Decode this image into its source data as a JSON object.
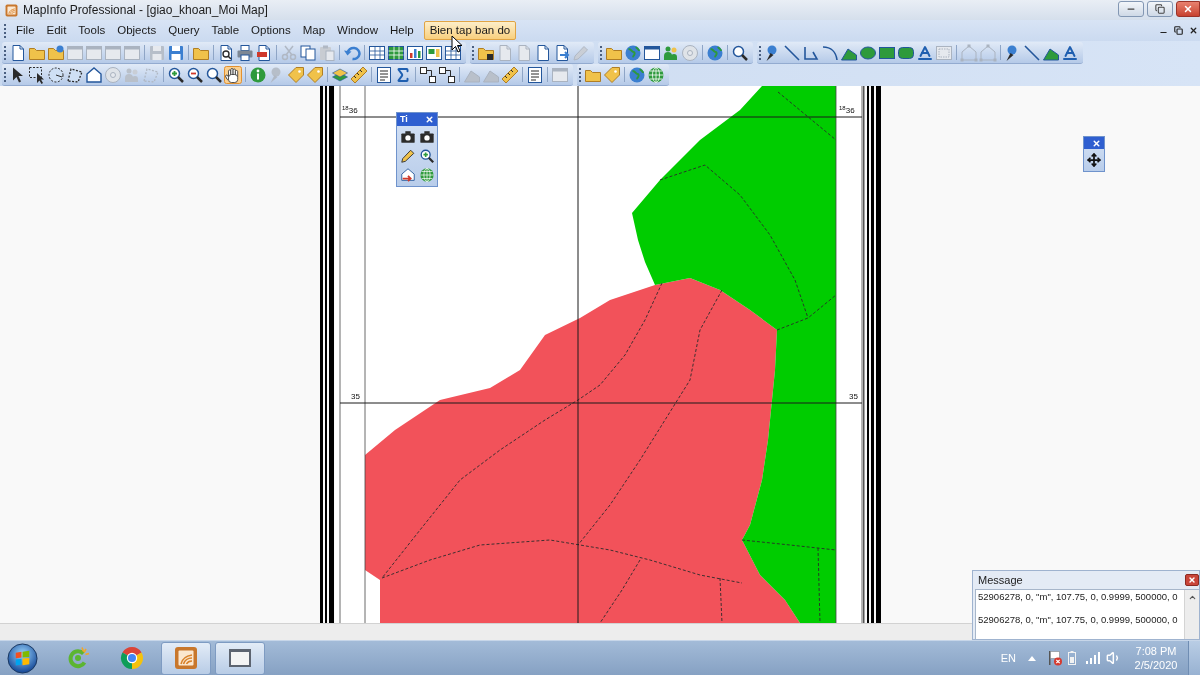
{
  "window": {
    "title": "MapInfo Professional - [giao_khoan_Moi Map]"
  },
  "menu": [
    {
      "label": "File",
      "selected": false
    },
    {
      "label": "Edit",
      "selected": false
    },
    {
      "label": "Tools",
      "selected": false
    },
    {
      "label": "Objects",
      "selected": false
    },
    {
      "label": "Query",
      "selected": false
    },
    {
      "label": "Table",
      "selected": false
    },
    {
      "label": "Options",
      "selected": false
    },
    {
      "label": "Map",
      "selected": false
    },
    {
      "label": "Window",
      "selected": false
    },
    {
      "label": "Help",
      "selected": false
    },
    {
      "label": "Bien tap ban do",
      "selected": true
    }
  ],
  "toolbar_rows": [
    [
      {
        "groups": [
          [
            {
              "disabled": false,
              "selected": false
            },
            {
              "disabled": false,
              "selected": false
            },
            {
              "disabled": false,
              "selected": false
            },
            {
              "disabled": true,
              "selected": false
            },
            {
              "disabled": true,
              "selected": false
            },
            {
              "disabled": true,
              "selected": false
            },
            {
              "disabled": true,
              "selected": false
            }
          ],
          [
            {
              "disabled": true,
              "selected": false
            },
            {
              "disabled": false,
              "selected": false
            }
          ],
          [
            {
              "disabled": false,
              "selected": false
            }
          ],
          [
            {
              "disabled": false,
              "selected": false
            },
            {
              "disabled": false,
              "selected": false
            },
            {
              "disabled": false,
              "selected": false
            }
          ],
          [
            {
              "disabled": true,
              "selected": false
            },
            {
              "disabled": false,
              "selected": false
            },
            {
              "disabled": true,
              "selected": false
            }
          ],
          [
            {
              "disabled": false,
              "selected": false
            }
          ],
          [
            {
              "disabled": false,
              "selected": false
            },
            {
              "disabled": false,
              "selected": false
            },
            {
              "disabled": false,
              "selected": false
            },
            {
              "disabled": false,
              "selected": false
            },
            {
              "disabled": false,
              "selected": false
            }
          ]
        ]
      },
      {
        "groups": [
          [
            {
              "disabled": false,
              "selected": false
            },
            {
              "disabled": true,
              "selected": false
            },
            {
              "disabled": true,
              "selected": false
            },
            {
              "disabled": false,
              "selected": false
            },
            {
              "disabled": false,
              "selected": false
            },
            {
              "disabled": true,
              "selected": false
            }
          ]
        ]
      },
      {
        "groups": [
          [
            {
              "disabled": false,
              "selected": false
            },
            {
              "disabled": false,
              "selected": false
            },
            {
              "disabled": false,
              "selected": false
            },
            {
              "disabled": false,
              "selected": false
            },
            {
              "disabled": true,
              "selected": false
            }
          ],
          [
            {
              "disabled": false,
              "selected": false
            }
          ],
          [
            {
              "disabled": false,
              "selected": false
            }
          ]
        ]
      },
      {
        "groups": [
          [
            {
              "disabled": false,
              "selected": false
            },
            {
              "disabled": false,
              "selected": false
            },
            {
              "disabled": false,
              "selected": false
            },
            {
              "disabled": false,
              "selected": false
            },
            {
              "disabled": false,
              "selected": false
            },
            {
              "disabled": false,
              "selected": false
            },
            {
              "disabled": false,
              "selected": false
            },
            {
              "disabled": false,
              "selected": false
            },
            {
              "disabled": false,
              "selected": false
            },
            {
              "disabled": true,
              "selected": false
            }
          ],
          [
            {
              "disabled": true,
              "selected": false
            },
            {
              "disabled": true,
              "selected": false
            }
          ],
          [
            {
              "disabled": false,
              "selected": false
            },
            {
              "disabled": false,
              "selected": false
            },
            {
              "disabled": false,
              "selected": false
            },
            {
              "disabled": false,
              "selected": false
            }
          ]
        ]
      }
    ],
    [
      {
        "groups": [
          [
            {
              "disabled": false,
              "selected": false
            },
            {
              "disabled": false,
              "selected": false
            },
            {
              "disabled": false,
              "selected": false
            },
            {
              "disabled": false,
              "selected": false
            },
            {
              "disabled": false,
              "selected": false
            },
            {
              "disabled": true,
              "selected": false
            },
            {
              "disabled": true,
              "selected": false
            },
            {
              "disabled": true,
              "selected": false
            }
          ],
          [
            {
              "disabled": false,
              "selected": false
            },
            {
              "disabled": false,
              "selected": false
            },
            {
              "disabled": false,
              "selected": false
            },
            {
              "disabled": false,
              "selected": true
            }
          ],
          [
            {
              "disabled": false,
              "selected": false
            },
            {
              "disabled": true,
              "selected": false
            },
            {
              "disabled": false,
              "selected": false
            },
            {
              "disabled": false,
              "selected": false
            }
          ],
          [
            {
              "disabled": false,
              "selected": false
            },
            {
              "disabled": false,
              "selected": false
            }
          ],
          [
            {
              "disabled": false,
              "selected": false
            },
            {
              "disabled": false,
              "selected": false
            }
          ],
          [
            {
              "disabled": false,
              "selected": false
            },
            {
              "disabled": false,
              "selected": false
            }
          ],
          [
            {
              "disabled": true,
              "selected": false
            },
            {
              "disabled": true,
              "selected": false
            },
            {
              "disabled": false,
              "selected": false
            }
          ],
          [
            {
              "disabled": false,
              "selected": false
            }
          ],
          [
            {
              "disabled": true,
              "selected": false
            }
          ]
        ]
      },
      {
        "groups": [
          [
            {
              "disabled": false,
              "selected": false
            },
            {
              "disabled": false,
              "selected": false
            }
          ],
          [
            {
              "disabled": false,
              "selected": false
            },
            {
              "disabled": false,
              "selected": false
            }
          ]
        ]
      }
    ]
  ],
  "map": {
    "grid_labels": [
      "$^{18}$36",
      "$^{18}$36",
      "35",
      "35"
    ]
  },
  "tool_palette": {
    "title": "Ti"
  },
  "message_window": {
    "title": "Message",
    "lines": [
      "52906278, 0, \"m\", 107.75, 0, 0.9999, 500000, 0",
      "52906278, 0, \"m\", 107.75, 0, 0.9999, 500000, 0"
    ]
  },
  "taskbar": {
    "apps": [
      {
        "active": false
      },
      {
        "active": false
      },
      {
        "active": true
      },
      {
        "active": true
      }
    ],
    "language": "EN",
    "time": "7:08 PM",
    "date": "2/5/2020"
  }
}
